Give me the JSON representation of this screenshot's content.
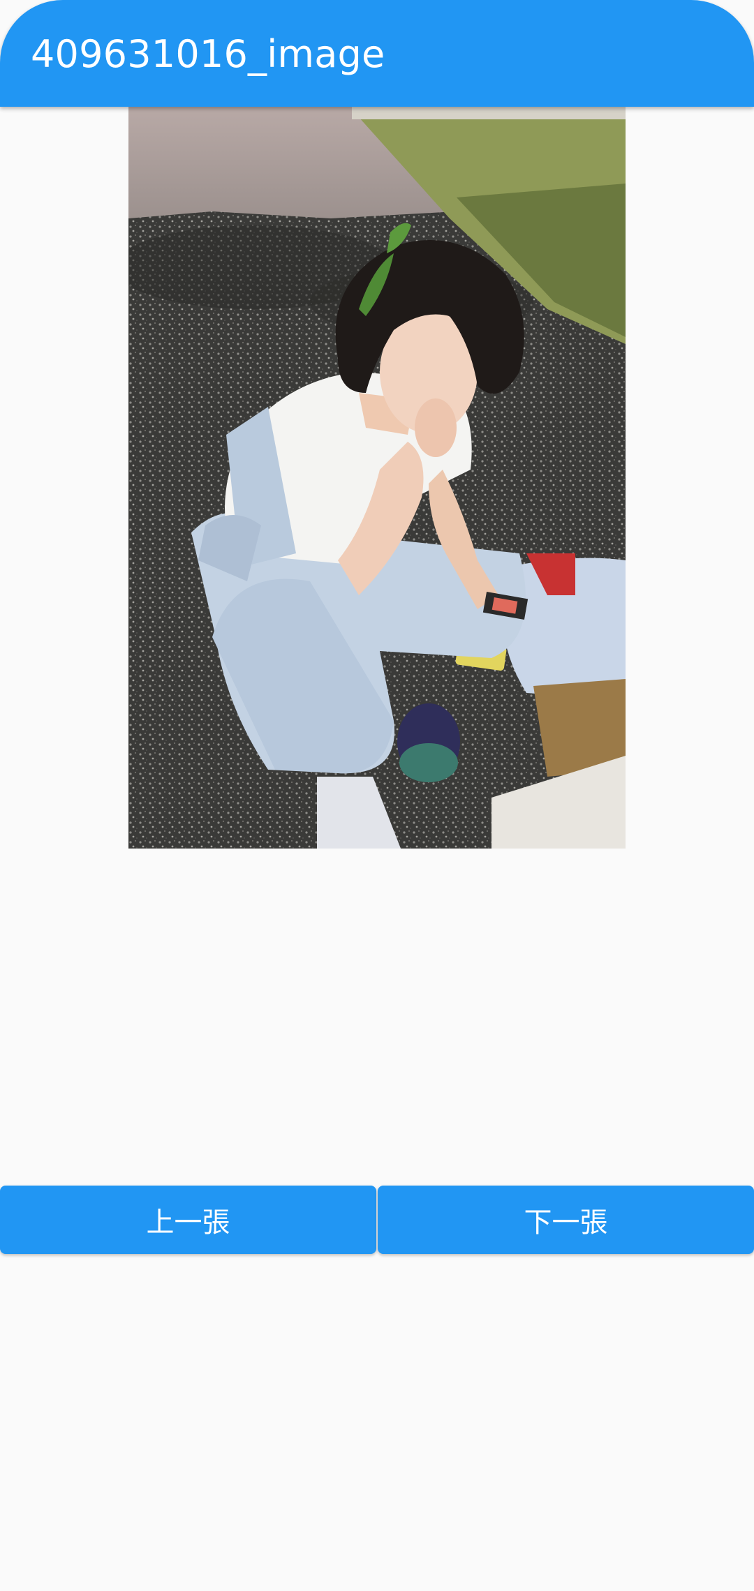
{
  "app_bar": {
    "title": "409631016_image",
    "color": "#2196f3"
  },
  "photo": {
    "icon": "photo-image",
    "description_visible": false
  },
  "buttons": {
    "prev_label": "上一張",
    "next_label": "下一張"
  }
}
